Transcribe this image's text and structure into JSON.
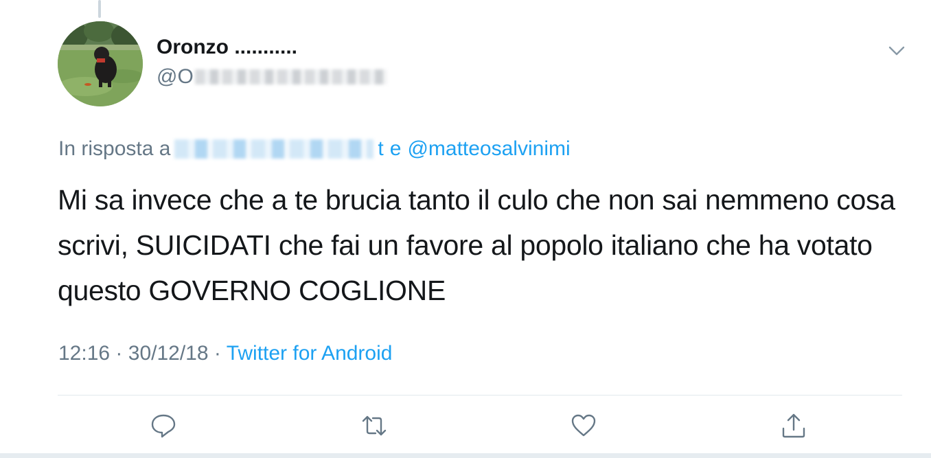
{
  "tweet": {
    "author": {
      "display_name": "Oronzo ...........",
      "handle": "@O"
    },
    "reply": {
      "prefix": "In risposta a",
      "suffix_letters": "t",
      "conjunction": "e",
      "mention": "@matteosalvinimi"
    },
    "text": "Mi sa invece che a te brucia tanto il culo che non sai nemmeno cosa scrivi, SUICIDATI che fai un favore al popolo italiano che ha votato questo GOVERNO COGLIONE",
    "time": "12:16",
    "separator": "·",
    "date": "30/12/18",
    "source": "Twitter for Android"
  },
  "icons": {
    "caret": "chevron-down-icon",
    "reply": "speech-bubble-icon",
    "retweet": "retweet-icon",
    "like": "heart-icon",
    "share": "share-icon"
  },
  "colors": {
    "text": "#14171a",
    "secondary": "#657786",
    "link": "#1da1f2",
    "divider": "#e1e8ed"
  }
}
